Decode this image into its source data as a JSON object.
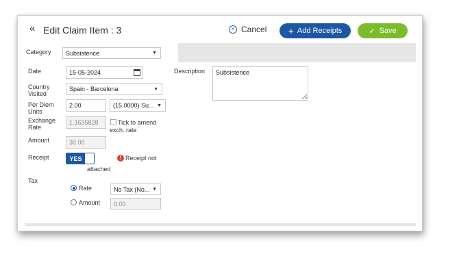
{
  "header": {
    "title": "Edit Claim Item : 3",
    "cancel_label": "Cancel",
    "add_receipts_label": "Add Receipts",
    "save_label": "Save"
  },
  "form": {
    "category": {
      "label": "Category",
      "value": "Subsistence"
    },
    "date": {
      "label": "Date",
      "value": "15-05-2024"
    },
    "country": {
      "label_line1": "Country",
      "label_line2": "Visited",
      "value": "Spain - Barcelona"
    },
    "per_diem": {
      "label_line1": "Per Diem",
      "label_line2": "Units",
      "value": "2.00",
      "rate_option": "(15.0000) Su..."
    },
    "exchange": {
      "label_line1": "Exchange",
      "label_line2": "Rate",
      "value": "1.1635828",
      "amend_line1": "Tick to amend",
      "amend_line2": "exch. rate"
    },
    "amount": {
      "label": "Amount",
      "value": "30.00"
    },
    "receipt": {
      "label": "Receipt",
      "toggle": "YES",
      "status_line1": "Receipt not",
      "status_line2": "attached"
    },
    "tax": {
      "label": "Tax",
      "rate_label": "Rate",
      "rate_value": "No Tax (No...",
      "amount_label": "Amount",
      "amount_value": "0.00"
    },
    "description": {
      "label": "Description",
      "value": "Subsistence"
    }
  },
  "colors": {
    "primary": "#1c57a5",
    "save": "#7cbc2b",
    "warning": "#d9432f"
  },
  "icons": [
    "double-chevron-left-icon",
    "cancel-x-icon",
    "plus-icon",
    "check-icon",
    "calendar-icon",
    "chevron-down-icon",
    "warning-icon"
  ]
}
